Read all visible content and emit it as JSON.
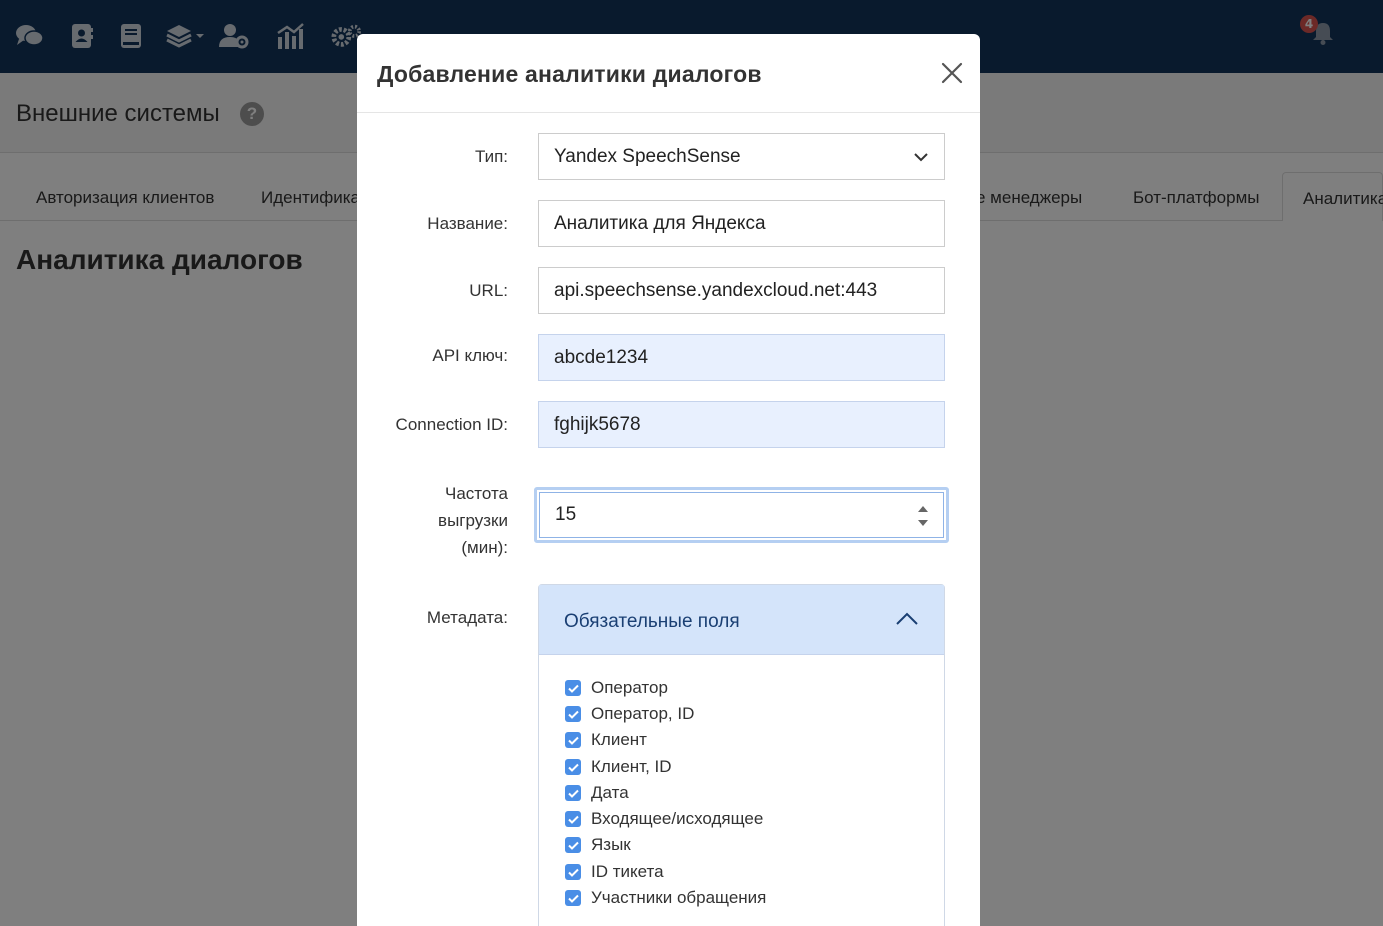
{
  "nav": {
    "icons": [
      "chats-icon",
      "contacts-icon",
      "knowledge-base-icon",
      "layers-dropdown-icon",
      "user-settings-icon",
      "analytics-icon",
      "settings-icon"
    ],
    "notification_count": "4"
  },
  "page": {
    "title": "Внешние системы",
    "help": "?",
    "section_title": "Аналитика диалогов"
  },
  "tabs": [
    {
      "label": "Авторизация клиентов"
    },
    {
      "label": "Идентифика"
    },
    {
      "label": "е менеджеры"
    },
    {
      "label": "Бот-платформы"
    },
    {
      "label": "Аналитика"
    }
  ],
  "modal": {
    "title": "Добавление аналитики диалогов",
    "fields": {
      "type": {
        "label": "Тип:",
        "value": "Yandex SpeechSense"
      },
      "name": {
        "label": "Название:",
        "value": "Аналитика для Яндекса"
      },
      "url": {
        "label": "URL:",
        "value": "api.speechsense.yandexcloud.net:443"
      },
      "api_key": {
        "label": "API ключ:",
        "value": "abcde1234"
      },
      "connection_id": {
        "label": "Connection ID:",
        "value": "fghijk5678"
      },
      "frequency": {
        "label_line1": "Частота",
        "label_line2": "выгрузки",
        "label_line3": "(мин):",
        "value": "15"
      },
      "metadata": {
        "label": "Метадата:"
      }
    },
    "accordion": {
      "title": "Обязательные поля",
      "items": [
        {
          "label": "Оператор",
          "checked": true
        },
        {
          "label": "Оператор, ID",
          "checked": true
        },
        {
          "label": "Клиент",
          "checked": true
        },
        {
          "label": "Клиент, ID",
          "checked": true
        },
        {
          "label": "Дата",
          "checked": true
        },
        {
          "label": "Входящее/исходящее",
          "checked": true
        },
        {
          "label": "Язык",
          "checked": true
        },
        {
          "label": "ID тикета",
          "checked": true
        },
        {
          "label": "Участники обращения",
          "checked": true
        }
      ]
    }
  },
  "colors": {
    "navbar": "#12355b",
    "accent": "#4a8ee6",
    "accordion_header": "#d4e4fa",
    "autofill": "#e8f0fe",
    "badge": "#d9534f"
  }
}
